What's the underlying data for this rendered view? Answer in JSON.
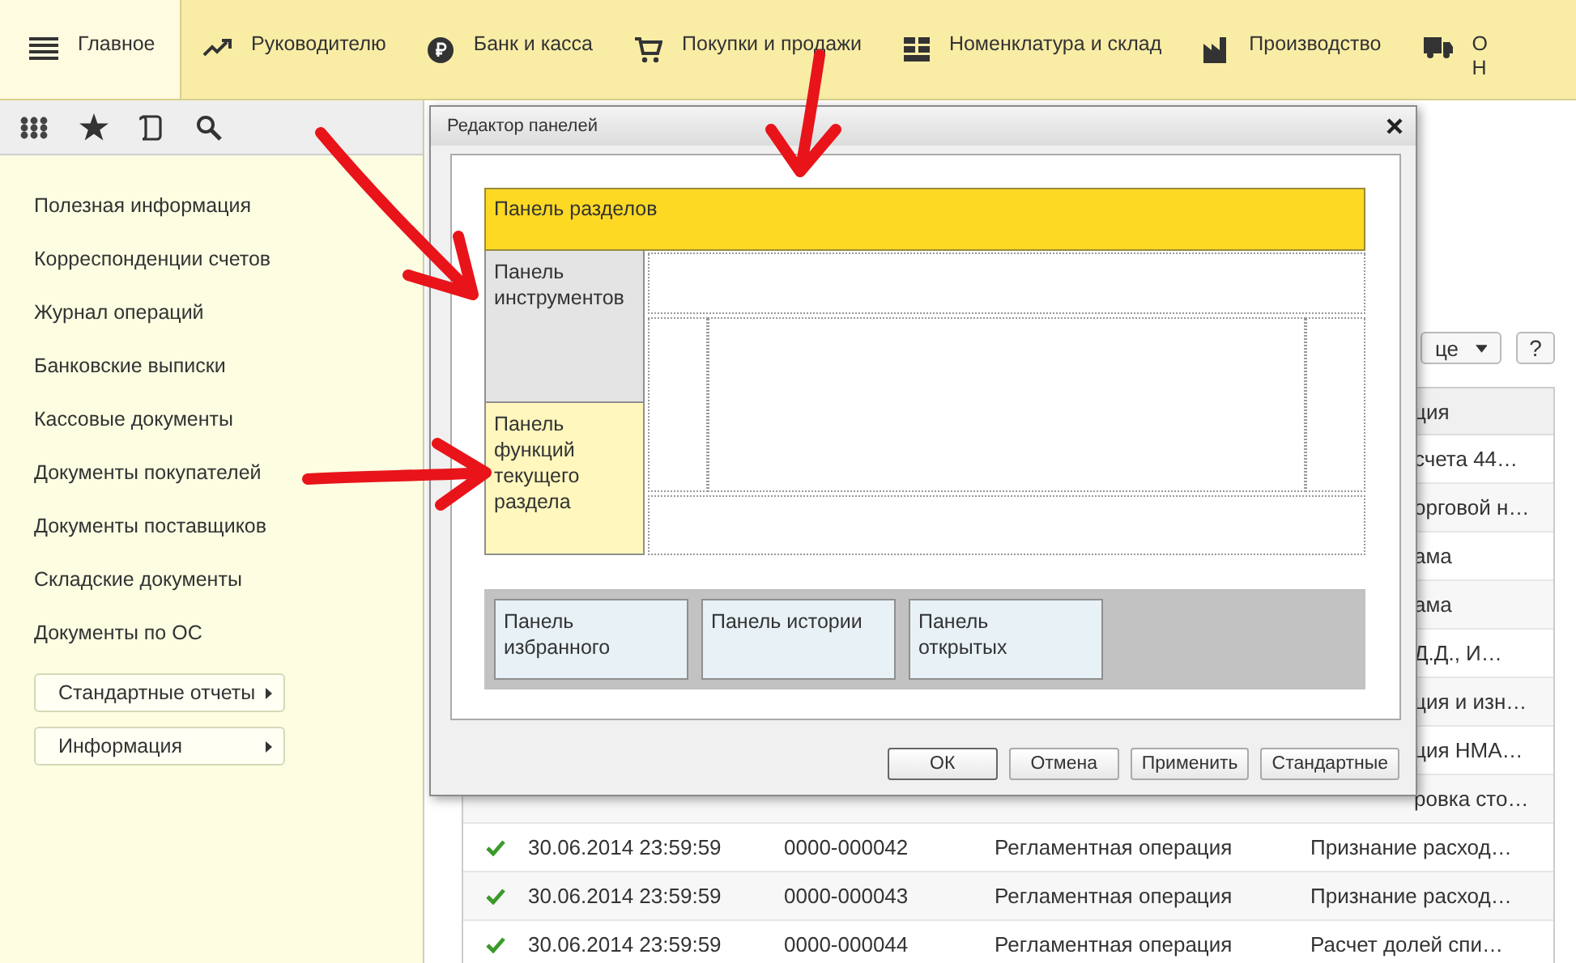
{
  "sections": [
    {
      "label": "Главное",
      "selected": true
    },
    {
      "label": "Руководителю",
      "selected": false
    },
    {
      "label": "Банк и касса",
      "selected": false
    },
    {
      "label": "Покупки и продажи",
      "selected": false
    },
    {
      "label": "Номенклатура и склад",
      "selected": false
    },
    {
      "label": "Производство",
      "selected": false
    },
    {
      "label": "О Н",
      "selected": false
    }
  ],
  "sidebar": {
    "items": [
      "Полезная информация",
      "Корреспонденции счетов",
      "Журнал операций",
      "Банковские выписки",
      "Кассовые документы",
      "Документы покупателей",
      "Документы поставщиков",
      "Складские документы",
      "Документы по ОС"
    ],
    "buttons": [
      "Стандартные отчеты",
      "Информация"
    ]
  },
  "toolbar": {
    "dropdown": "це",
    "help": "?"
  },
  "table": {
    "header": "ция",
    "rows": [
      {
        "kind": "partial",
        "content": "счета 44…"
      },
      {
        "kind": "partial",
        "content": "орговой н…"
      },
      {
        "kind": "partial",
        "content": "ама"
      },
      {
        "kind": "partial",
        "content": "ама"
      },
      {
        "kind": "partial",
        "content": "Д.Д., И…"
      },
      {
        "kind": "partial",
        "content": "ция и изн…"
      },
      {
        "kind": "partial",
        "content": "ция НМА…"
      },
      {
        "kind": "partial",
        "content": "ровка сто…"
      },
      {
        "kind": "full",
        "posted": true,
        "date": "30.06.2014 23:59:59",
        "number": "0000-000042",
        "type": "Регламентная операция",
        "content": "Признание расход…"
      },
      {
        "kind": "full",
        "posted": true,
        "date": "30.06.2014 23:59:59",
        "number": "0000-000043",
        "type": "Регламентная операция",
        "content": "Признание расход…"
      },
      {
        "kind": "full",
        "posted": true,
        "date": "30.06.2014 23:59:59",
        "number": "0000-000044",
        "type": "Регламентная операция",
        "content": "Расчет долей спи…"
      }
    ]
  },
  "dialog": {
    "title": "Редактор панелей",
    "layout": {
      "sections_panel": "Панель разделов",
      "tools_panel": "Панель инструментов",
      "functions_panel": "Панель функций текущего раздела",
      "bottom_panels": [
        "Панель избранного",
        "Панель истории",
        "Панель открытых"
      ]
    },
    "buttons": [
      {
        "label": "ОК",
        "default": true
      },
      {
        "label": "Отмена",
        "default": false
      },
      {
        "label": "Применить",
        "default": false
      },
      {
        "label": "Стандартные",
        "default": false
      }
    ]
  }
}
